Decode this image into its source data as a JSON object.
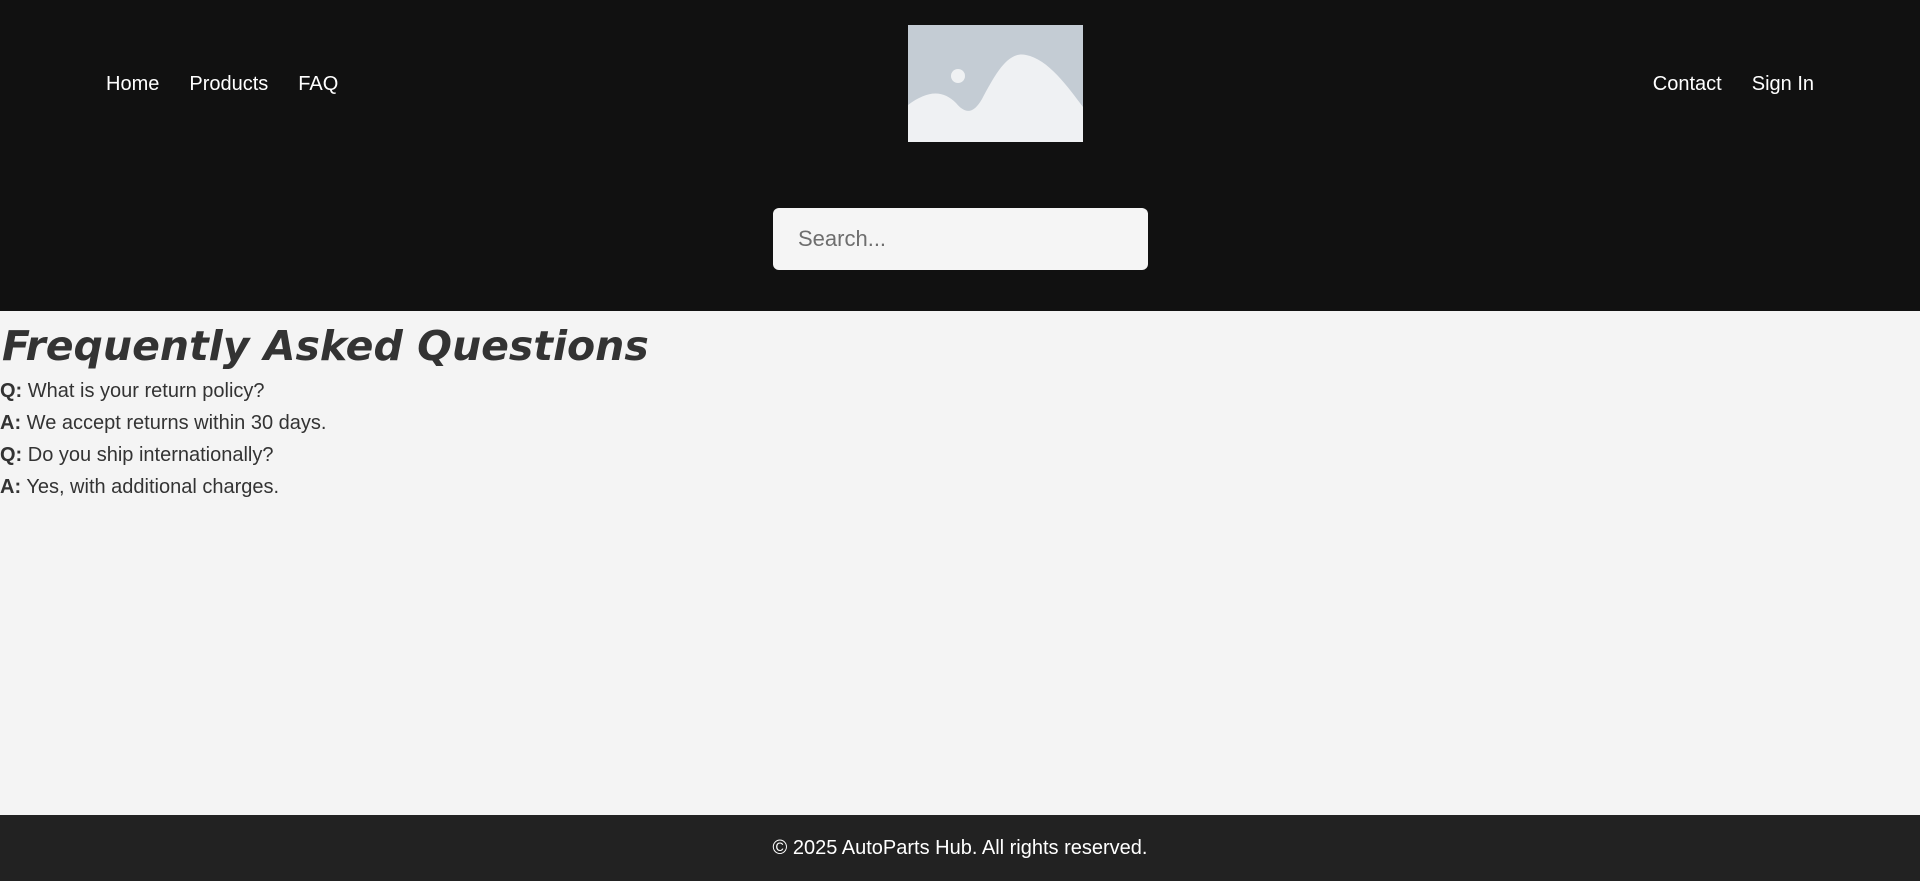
{
  "header": {
    "nav_left": [
      {
        "label": "Home"
      },
      {
        "label": "Products"
      },
      {
        "label": "FAQ"
      }
    ],
    "nav_right": [
      {
        "label": "Contact"
      },
      {
        "label": "Sign In"
      }
    ],
    "logo_icon": "image-placeholder-icon",
    "search": {
      "placeholder": "Search...",
      "value": ""
    }
  },
  "main": {
    "title": "Frequently Asked Questions",
    "faq": [
      {
        "prefix": "Q:",
        "text": "What is your return policy?"
      },
      {
        "prefix": "A:",
        "text": "We accept returns within 30 days."
      },
      {
        "prefix": "Q:",
        "text": "Do you ship internationally?"
      },
      {
        "prefix": "A:",
        "text": "Yes, with additional charges."
      }
    ]
  },
  "footer": {
    "text": "© 2025 AutoParts Hub. All rights reserved."
  },
  "colors": {
    "header_bg": "#111111",
    "page_bg": "#f4f4f4",
    "footer_bg": "#222222",
    "text": "#333333",
    "nav_text": "#ffffff"
  }
}
